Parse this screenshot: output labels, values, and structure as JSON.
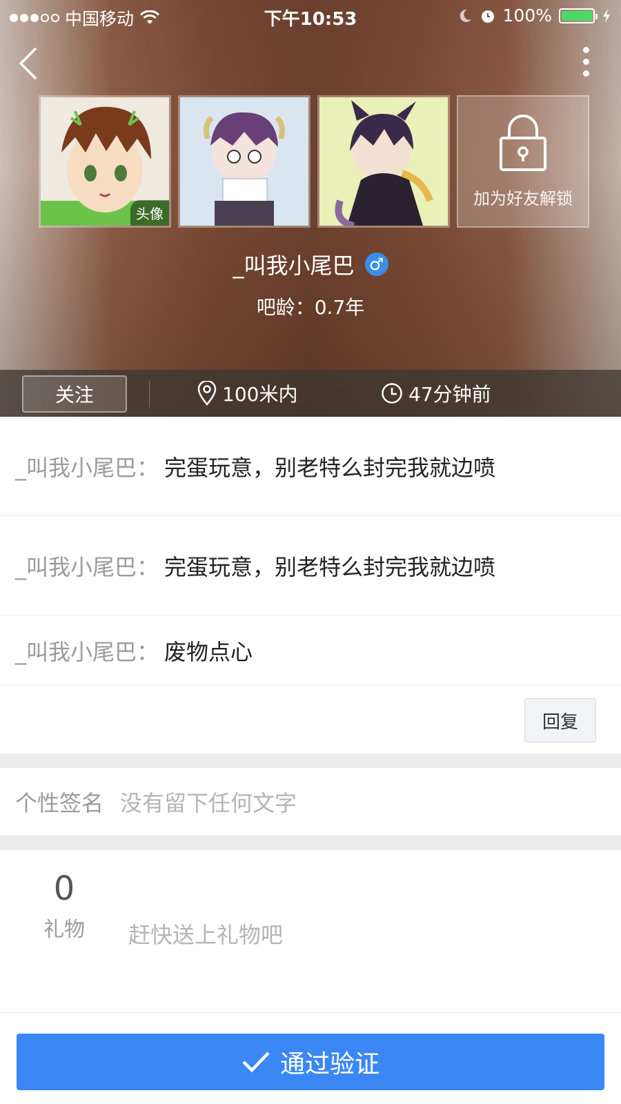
{
  "status_bar": {
    "carrier": "中国移动",
    "time": "下午10:53",
    "battery": "100%"
  },
  "colors": {
    "accent_blue": "#3b88f5",
    "gender_blue": "#3a8ee6",
    "battery_green": "#4cd964"
  },
  "profile": {
    "photos": [
      {
        "tag": "头像"
      },
      {
        "tag": ""
      },
      {
        "tag": ""
      }
    ],
    "lock_label": "加为好友解锁",
    "name": "_叫我小尾巴",
    "gender_symbol": "♂",
    "bar_age": "吧龄：0.7年"
  },
  "info_strip": {
    "follow_label": "关注",
    "distance": "100米内",
    "last_seen": "47分钟前"
  },
  "messages": [
    {
      "sender": "_叫我小尾巴：",
      "text": "完蛋玩意，别老特么封完我就边喷"
    },
    {
      "sender": "_叫我小尾巴：",
      "text": "完蛋玩意，别老特么封完我就边喷"
    },
    {
      "sender": "_叫我小尾巴：",
      "text": "废物点心"
    }
  ],
  "reply_label": "回复",
  "signature": {
    "label": "个性签名",
    "value": "没有留下任何文字"
  },
  "gifts": {
    "count": "0",
    "label": "礼物",
    "hint": "赶快送上礼物吧"
  },
  "verify_label": "通过验证"
}
